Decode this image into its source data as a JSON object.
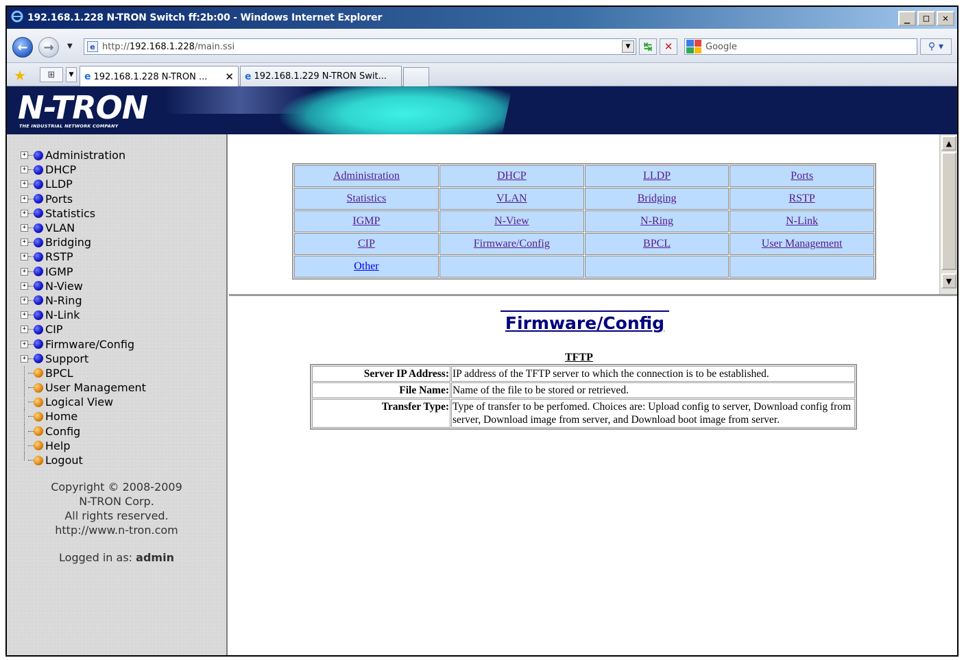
{
  "window": {
    "title": "192.168.1.228 N-TRON Switch ff:2b:00 - Windows Internet Explorer",
    "buttons": {
      "minimize": "_",
      "maximize": "□",
      "close": "✕"
    }
  },
  "address": {
    "prefix": "http://",
    "host": "192.168.1.228",
    "path": "/main.ssi",
    "search_placeholder": "Google"
  },
  "tabs": [
    {
      "label": "192.168.1.228 N-TRON ...",
      "active": true,
      "close": "✕"
    },
    {
      "label": "192.168.1.229 N-TRON Swit...",
      "active": false
    }
  ],
  "banner": {
    "logo": "N-TRON",
    "tagline": "THE INDUSTRIAL NETWORK COMPANY"
  },
  "sidebar": {
    "tree": [
      {
        "label": "Administration",
        "expandable": true,
        "color": "blue"
      },
      {
        "label": "DHCP",
        "expandable": true,
        "color": "blue"
      },
      {
        "label": "LLDP",
        "expandable": true,
        "color": "blue"
      },
      {
        "label": "Ports",
        "expandable": true,
        "color": "blue"
      },
      {
        "label": "Statistics",
        "expandable": true,
        "color": "blue"
      },
      {
        "label": "VLAN",
        "expandable": true,
        "color": "blue"
      },
      {
        "label": "Bridging",
        "expandable": true,
        "color": "blue"
      },
      {
        "label": "RSTP",
        "expandable": true,
        "color": "blue"
      },
      {
        "label": "IGMP",
        "expandable": true,
        "color": "blue"
      },
      {
        "label": "N-View",
        "expandable": true,
        "color": "blue"
      },
      {
        "label": "N-Ring",
        "expandable": true,
        "color": "blue"
      },
      {
        "label": "N-Link",
        "expandable": true,
        "color": "blue"
      },
      {
        "label": "CIP",
        "expandable": true,
        "color": "blue"
      },
      {
        "label": "Firmware/Config",
        "expandable": true,
        "color": "blue"
      },
      {
        "label": "Support",
        "expandable": true,
        "color": "blue"
      },
      {
        "label": "BPCL",
        "expandable": false,
        "color": "orange"
      },
      {
        "label": "User Management",
        "expandable": false,
        "color": "orange"
      },
      {
        "label": "Logical View",
        "expandable": false,
        "color": "orange"
      },
      {
        "label": "Home",
        "expandable": false,
        "color": "orange"
      },
      {
        "label": "Config",
        "expandable": false,
        "color": "orange"
      },
      {
        "label": "Help",
        "expandable": false,
        "color": "orange"
      },
      {
        "label": "Logout",
        "expandable": false,
        "color": "orange"
      }
    ],
    "copyright": [
      "Copyright © 2008-2009",
      "N-TRON Corp.",
      "All rights reserved.",
      "http://www.n-tron.com"
    ],
    "logged_in_prefix": "Logged in as:",
    "logged_in_user": "admin"
  },
  "help_nav": {
    "rows": [
      [
        "Administration",
        "DHCP",
        "LLDP",
        "Ports"
      ],
      [
        "Statistics",
        "VLAN",
        "Bridging",
        "RSTP"
      ],
      [
        "IGMP",
        "N-View",
        "N-Ring",
        "N-Link"
      ],
      [
        "CIP",
        "Firmware/Config",
        "BPCL",
        "User Management"
      ],
      [
        "Other",
        "",
        "",
        ""
      ]
    ],
    "unvisited": [
      "Other"
    ]
  },
  "main": {
    "title": "Firmware/Config",
    "section": "TFTP",
    "rows": [
      {
        "label": "Server IP Address:",
        "text": "IP address of the TFTP server to which the connection is to be established."
      },
      {
        "label": "File Name:",
        "text": "Name of the file to be stored or retrieved."
      },
      {
        "label": "Transfer Type:",
        "text": "Type of transfer to be perfomed. Choices are: Upload config to server, Download config from server, Download image from server, and Download boot image from server."
      }
    ]
  },
  "colors": {
    "banner": "#0b1a52",
    "nav_cell": "#bcdcff",
    "title": "#000080"
  }
}
